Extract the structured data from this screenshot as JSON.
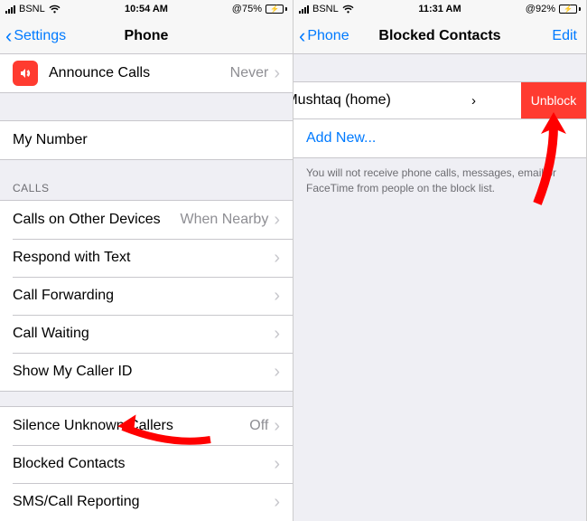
{
  "left": {
    "status": {
      "carrier": "BSNL",
      "time": "10:54 AM",
      "battery_pct": "75%",
      "battery_fill": 75
    },
    "nav": {
      "back": "Settings",
      "title": "Phone"
    },
    "announce": {
      "label": "Announce Calls",
      "value": "Never"
    },
    "my_number": "My Number",
    "section_calls": "CALLS",
    "rows": {
      "other_devices": {
        "label": "Calls on Other Devices",
        "value": "When Nearby"
      },
      "respond": {
        "label": "Respond with Text"
      },
      "forwarding": {
        "label": "Call Forwarding"
      },
      "waiting": {
        "label": "Call Waiting"
      },
      "caller_id": {
        "label": "Show My Caller ID"
      }
    },
    "rows2": {
      "silence": {
        "label": "Silence Unknown Callers",
        "value": "Off"
      },
      "blocked": {
        "label": "Blocked Contacts"
      },
      "sms": {
        "label": "SMS/Call Reporting"
      }
    }
  },
  "right": {
    "status": {
      "carrier": "BSNL",
      "time": "11:31 AM",
      "battery_pct": "92%",
      "battery_fill": 92
    },
    "nav": {
      "back": "Phone",
      "title": "Blocked Contacts",
      "edit": "Edit"
    },
    "contact": {
      "name": "n Mushtaq (home)",
      "action": "Unblock"
    },
    "add_new": "Add New...",
    "footer": "You will not receive phone calls, messages, email or FaceTime from people on the block list."
  },
  "colors": {
    "accent": "#007aff",
    "destructive": "#ff3b30"
  }
}
